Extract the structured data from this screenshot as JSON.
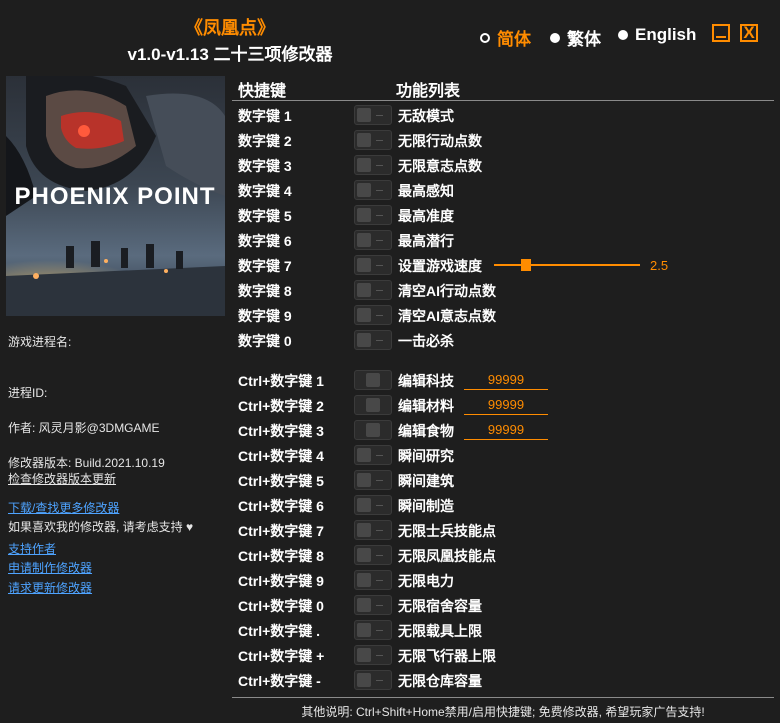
{
  "header": {
    "title": "《凤凰点》",
    "subtitle": "v1.0-v1.13 二十三项修改器"
  },
  "languages": [
    {
      "label": "简体",
      "selected": true
    },
    {
      "label": "繁体",
      "selected": false
    },
    {
      "label": "English",
      "selected": false
    }
  ],
  "window": {
    "minimize_icon": "minimize-icon",
    "close_label": "X"
  },
  "cover": {
    "logo_text": "PHOENIX POINT"
  },
  "sidebar": {
    "process_name_label": "游戏进程名:",
    "process_id_label": "进程ID:",
    "author": "作者: 风灵月影@3DMGAME",
    "version": "修改器版本: Build.2021.10.19",
    "check_update": "检查修改器版本更新",
    "download_link": "下载/查找更多修改器",
    "support_text": "如果喜欢我的修改器, 请考虑支持",
    "heart_icon": "heart-icon",
    "support_link": "支持作者",
    "request_link": "申请制作修改器",
    "request_update_link": "请求更新修改器"
  },
  "columns": {
    "hotkey": "快捷键",
    "function": "功能列表"
  },
  "options": [
    {
      "hotkey": "数字键 1",
      "label": "无敌模式",
      "type": "toggle"
    },
    {
      "hotkey": "数字键 2",
      "label": "无限行动点数",
      "type": "toggle"
    },
    {
      "hotkey": "数字键 3",
      "label": "无限意志点数",
      "type": "toggle"
    },
    {
      "hotkey": "数字键 4",
      "label": "最高感知",
      "type": "toggle"
    },
    {
      "hotkey": "数字键 5",
      "label": "最高准度",
      "type": "toggle"
    },
    {
      "hotkey": "数字键 6",
      "label": "最高潜行",
      "type": "toggle"
    },
    {
      "hotkey": "数字键 7",
      "label": "设置游戏速度",
      "type": "slider",
      "value": "2.5"
    },
    {
      "hotkey": "数字键 8",
      "label": "清空AI行动点数",
      "type": "toggle"
    },
    {
      "hotkey": "数字键 9",
      "label": "清空AI意志点数",
      "type": "toggle"
    },
    {
      "hotkey": "数字键 0",
      "label": "一击必杀",
      "type": "toggle"
    },
    {
      "hotkey": "Ctrl+数字键 1",
      "label": "编辑科技",
      "type": "button",
      "value": "99999"
    },
    {
      "hotkey": "Ctrl+数字键 2",
      "label": "编辑材料",
      "type": "button",
      "value": "99999"
    },
    {
      "hotkey": "Ctrl+数字键 3",
      "label": "编辑食物",
      "type": "button",
      "value": "99999"
    },
    {
      "hotkey": "Ctrl+数字键 4",
      "label": "瞬间研究",
      "type": "toggle"
    },
    {
      "hotkey": "Ctrl+数字键 5",
      "label": "瞬间建筑",
      "type": "toggle"
    },
    {
      "hotkey": "Ctrl+数字键 6",
      "label": "瞬间制造",
      "type": "toggle"
    },
    {
      "hotkey": "Ctrl+数字键 7",
      "label": "无限士兵技能点",
      "type": "toggle"
    },
    {
      "hotkey": "Ctrl+数字键 8",
      "label": "无限凤凰技能点",
      "type": "toggle"
    },
    {
      "hotkey": "Ctrl+数字键 9",
      "label": "无限电力",
      "type": "toggle"
    },
    {
      "hotkey": "Ctrl+数字键 0",
      "label": "无限宿舍容量",
      "type": "toggle"
    },
    {
      "hotkey": "Ctrl+数字键 .",
      "label": "无限载具上限",
      "type": "toggle"
    },
    {
      "hotkey": "Ctrl+数字键 +",
      "label": "无限飞行器上限",
      "type": "toggle"
    },
    {
      "hotkey": "Ctrl+数字键 -",
      "label": "无限仓库容量",
      "type": "toggle"
    }
  ],
  "slider_level": 0.2,
  "footer": "其他说明: Ctrl+Shift+Home禁用/启用快捷键; 免费修改器, 希望玩家广告支持!",
  "colors": {
    "accent": "#ff8c00",
    "background": "#1e1e1e",
    "link": "#4ea3ff"
  }
}
